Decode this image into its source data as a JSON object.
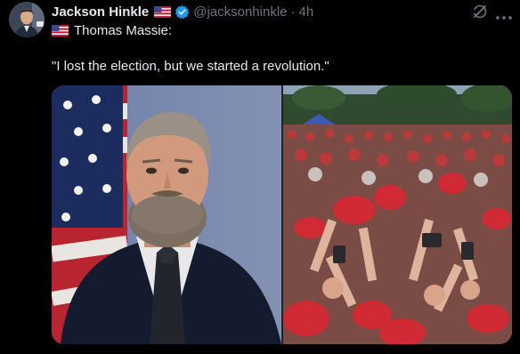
{
  "post": {
    "author": {
      "display_name": "Jackson Hinkle",
      "handle": "@jacksonhinkle",
      "flag_icon": "us-flag-icon",
      "verified_icon": "verified-badge-icon",
      "accent_color": "#1d9bf0"
    },
    "separator": "·",
    "timestamp": "4h",
    "actions": {
      "grok_icon": "grok-icon",
      "more_icon": "more-options-icon"
    },
    "text": {
      "line1": "Thomas Massie:",
      "quote": "\"I lost the election, but we started a revolution.\""
    },
    "media": {
      "left_image": "portrait-photo",
      "right_image": "crowd-photo"
    }
  },
  "colors": {
    "background": "#000000",
    "primary_text": "#e7e9ea",
    "secondary_text": "#71767b"
  }
}
